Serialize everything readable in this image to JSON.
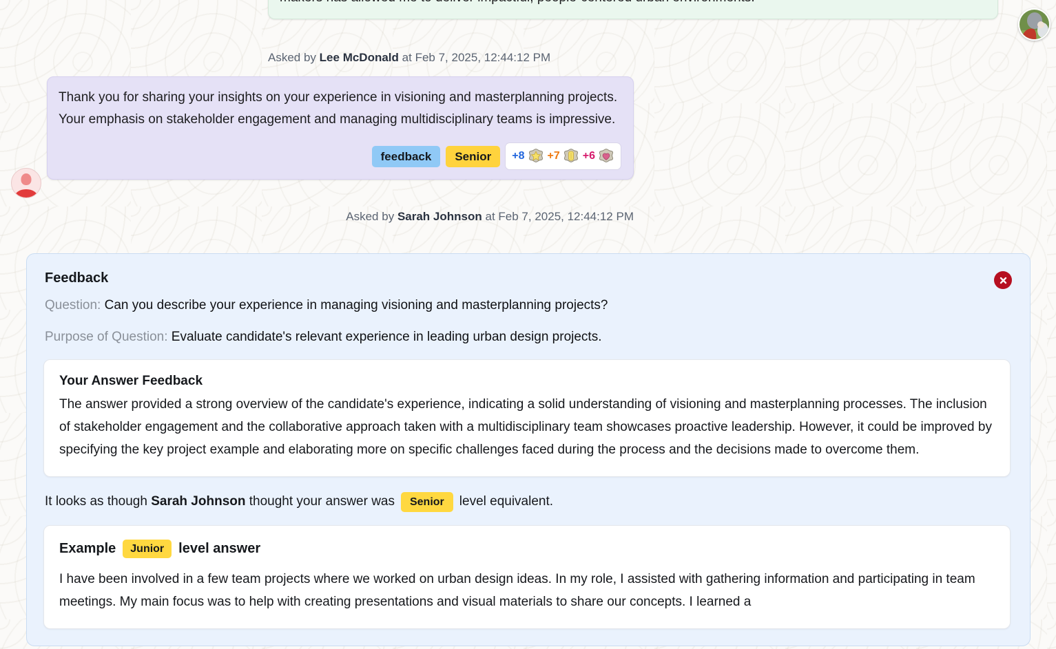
{
  "messages": [
    {
      "id": "msg-interviewer",
      "side": "right",
      "variant": "green",
      "text": "and implementable. My experience managing budgets, coordinating diverse teams, and presenting to key decision-makers has allowed me to deliver impactful, people-centered urban environments.",
      "meta_prefix": "Asked by",
      "author": "Lee McDonald",
      "meta_mid": "at",
      "timestamp": "Feb 7, 2025, 12:44:12 PM"
    },
    {
      "id": "msg-candidate",
      "side": "left",
      "variant": "purple",
      "text": "Thank you for sharing your insights on your experience in visioning and masterplanning projects. Your emphasis on stakeholder engagement and managing multidisciplinary teams is impressive.",
      "meta_prefix": "Asked by",
      "author": "Sarah Johnson",
      "meta_mid": "at",
      "timestamp": "Feb 7, 2025, 12:44:12 PM",
      "tags": [
        {
          "label": "feedback",
          "style": "blue"
        },
        {
          "label": "Senior",
          "style": "gold"
        }
      ],
      "scores": [
        {
          "value": "+8",
          "icon": "star-medal-icon",
          "color": "#2266dd"
        },
        {
          "value": "+7",
          "icon": "scroll-medal-icon",
          "color": "#ef7a10"
        },
        {
          "value": "+6",
          "icon": "heart-medal-icon",
          "color": "#d6196b"
        }
      ]
    }
  ],
  "feedback_panel": {
    "title": "Feedback",
    "close_label": "close-icon",
    "question_label": "Question:",
    "question_text": "Can you describe your experience in managing visioning and masterplanning projects?",
    "purpose_label": "Purpose of Question:",
    "purpose_text": "Evaluate candidate's relevant experience in leading urban design projects.",
    "answer_feedback": {
      "title": "Your Answer Feedback",
      "body": "The answer provided a strong overview of the candidate's experience, indicating a solid understanding of visioning and masterplanning processes. The inclusion of stakeholder engagement and the collaborative approach taken with a multidisciplinary team showcases proactive leadership. However, it could be improved by specifying the key project example and elaborating more on specific challenges faced during the process and the decisions made to overcome them."
    },
    "verdict": {
      "prefix": "It looks as though",
      "person": "Sarah Johnson",
      "middle": "thought your answer was",
      "level": "Senior",
      "suffix": "level equivalent."
    },
    "example": {
      "heading_prefix": "Example",
      "level": "Junior",
      "heading_suffix": "level answer",
      "body": "I have been involved in a few team projects where we worked on urban design ideas. In my role, I assisted with gathering information and participating in team meetings. My main focus was to help with creating presentations and visual materials to share our concepts. I learned a"
    }
  },
  "avatars": {
    "interviewer_alt": "user-photo-avatar",
    "candidate_alt": "user-silhouette-avatar"
  },
  "colors": {
    "panel_bg": "#eaf2fd",
    "bubble_green": "#eaf7ee",
    "bubble_purple": "#e5e1f6",
    "tag_blue": "#90c9f6",
    "tag_gold": "#ffd33d",
    "close_red": "#b60f20"
  }
}
